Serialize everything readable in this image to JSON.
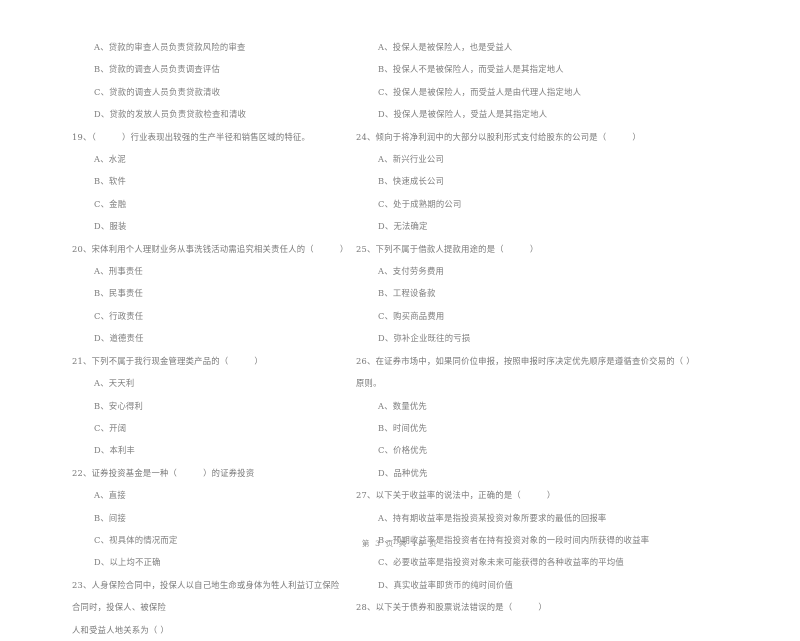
{
  "document": {
    "type": "exam-paper",
    "language": "zh-CN",
    "footer": "第 3 页  共 18 页"
  },
  "left_column": {
    "blocks": [
      {
        "kind": "options_continued",
        "options": [
          "A、贷款的审查人员负责贷款风险的审查",
          "B、贷款的调查人员负责调查评估",
          "C、贷款的调查人员负责贷款清收",
          "D、贷款的发放人员负责贷款检查和清收"
        ]
      },
      {
        "kind": "question",
        "number": "19、",
        "stem_before": "（",
        "stem_after": "）行业表现出较强的生产半径和销售区域的特征。",
        "options": [
          "A、水泥",
          "B、软件",
          "C、金融",
          "D、服装"
        ]
      },
      {
        "kind": "question",
        "number": "20、",
        "stem_before": "宋体利用个人理财业务从事洗钱活动需追究相关责任人的（",
        "stem_after": "）",
        "options": [
          "A、刑事责任",
          "B、民事责任",
          "C、行政责任",
          "D、道德责任"
        ]
      },
      {
        "kind": "question",
        "number": "21、",
        "stem_before": "下列不属于我行现金管理类产品的（",
        "stem_after": "）",
        "options": [
          "A、天天利",
          "B、安心得利",
          "C、开阔",
          "D、本利丰"
        ]
      },
      {
        "kind": "question",
        "number": "22、",
        "stem_before": "证券投资基金是一种（",
        "stem_after": "）的证券投资",
        "options": [
          "A、直接",
          "B、间接",
          "C、视具体的情况而定",
          "D、以上均不正确"
        ]
      },
      {
        "kind": "question_wrap",
        "number": "23、",
        "stem_line1": "人身保险合同中，投保人以自己地生命或身体为牲人利益订立保险合同时，投保人、被保险",
        "stem_line2": "人和受益人地关系为（     ）",
        "options": []
      }
    ]
  },
  "right_column": {
    "blocks": [
      {
        "kind": "options_continued",
        "options": [
          "A、投保人是被保险人，也是受益人",
          "B、投保人不是被保险人，而受益人是其指定地人",
          "C、投保人是被保险人，而受益人是由代理人指定地人",
          "D、投保人是被保险人，受益人是其指定地人"
        ]
      },
      {
        "kind": "question",
        "number": "24、",
        "stem_before": "倾向于将净利润中的大部分以股利形式支付给股东的公司是（",
        "stem_after": "）",
        "options": [
          "A、新兴行业公司",
          "B、快速成长公司",
          "C、处于成熟期的公司",
          "D、无法确定"
        ]
      },
      {
        "kind": "question",
        "number": "25、",
        "stem_before": "下列不属于借款人提款用途的是（",
        "stem_after": "）",
        "options": [
          "A、支付劳务费用",
          "B、工程设备款",
          "C、购买商品费用",
          "D、弥补企业既往的亏损"
        ]
      },
      {
        "kind": "question_wrap",
        "number": "26、",
        "stem_line1": "在证券市场中，如果同价位申报，按照申报时序决定优先顺序是遵循查价交易的（      ）",
        "stem_line2": "原则。",
        "options": [
          "A、数量优先",
          "B、时间优先",
          "C、价格优先",
          "D、品种优先"
        ]
      },
      {
        "kind": "question",
        "number": "27、",
        "stem_before": "以下关于收益率的说法中，正确的是（",
        "stem_after": "）",
        "options": [
          "A、持有期收益率是指投资某投资对象所要求的最低的回报率",
          "B、预期收益率是指投资者在持有投资对象的一段时间内所获得的收益率",
          "C、必要收益率是指投资对象未来可能获得的各种收益率的平均值",
          "D、真实收益率即货币的纯时间价值"
        ]
      },
      {
        "kind": "question",
        "number": "28、",
        "stem_before": "以下关于债券和股票说法错误的是（",
        "stem_after": "）",
        "options": []
      }
    ]
  }
}
